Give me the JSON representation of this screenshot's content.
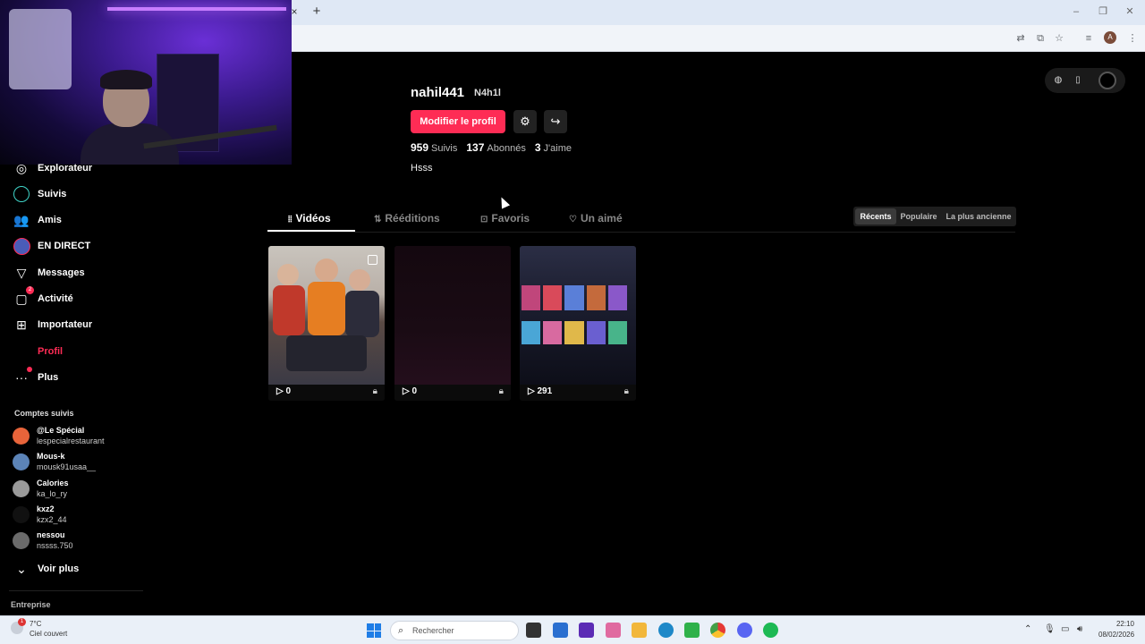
{
  "browser": {
    "close_tab": "×",
    "new_tab": "+",
    "avatar_letter": "A"
  },
  "sidebar": {
    "items": [
      {
        "label": "Explorateur",
        "icon": "compass-icon"
      },
      {
        "label": "Suivis",
        "icon": "following-icon"
      },
      {
        "label": "Amis",
        "icon": "friends-icon"
      },
      {
        "label": "EN DIRECT",
        "icon": "live-icon"
      },
      {
        "label": "Messages",
        "icon": "send-icon"
      },
      {
        "label": "Activité",
        "icon": "activity-icon",
        "badge": "2"
      },
      {
        "label": "Importateur",
        "icon": "upload-icon"
      },
      {
        "label": "Profil",
        "icon": "profile-icon"
      },
      {
        "label": "Plus",
        "icon": "more-icon"
      }
    ],
    "following_title": "Comptes suivis",
    "accounts": [
      {
        "name": "@Le Spécial",
        "handle": "lespecialrestaurant",
        "color": "#e8643a"
      },
      {
        "name": "Mous-k",
        "handle": "mousk91usaa__",
        "color": "#5c84b8"
      },
      {
        "name": "Calories",
        "handle": "ka_lo_ry",
        "color": "#9a9a9a"
      },
      {
        "name": "kxz2",
        "handle": "kzx2_44",
        "color": "#111111"
      },
      {
        "name": "nessou",
        "handle": "nssss.750",
        "color": "#6b6b6b"
      }
    ],
    "see_more": "Voir plus",
    "company": "Entreprise"
  },
  "profile": {
    "username": "nahil441",
    "nickname": "N4h1l",
    "edit_button": "Modifier le profil",
    "following_count": "959",
    "following_label": "Suivis",
    "followers_count": "137",
    "followers_label": "Abonnés",
    "likes_count": "3",
    "likes_label": "J'aime",
    "bio": "Hsss"
  },
  "tabs": {
    "videos": "Vidéos",
    "reposts": "Rééditions",
    "favorites": "Favoris",
    "liked": "Un aimé"
  },
  "sort": {
    "recent": "Récents",
    "popular": "Populaire",
    "oldest": "La plus ancienne"
  },
  "videos": [
    {
      "views": "0"
    },
    {
      "views": "0"
    },
    {
      "views": "291"
    }
  ],
  "taskbar": {
    "weather_badge": "1",
    "temperature": "7°C",
    "weather": "Ciel couvert",
    "search_placeholder": "Rechercher",
    "time": "22:10",
    "date": "08/02/2026"
  },
  "colors": {
    "accent": "#fe2c55",
    "background": "#000000"
  }
}
